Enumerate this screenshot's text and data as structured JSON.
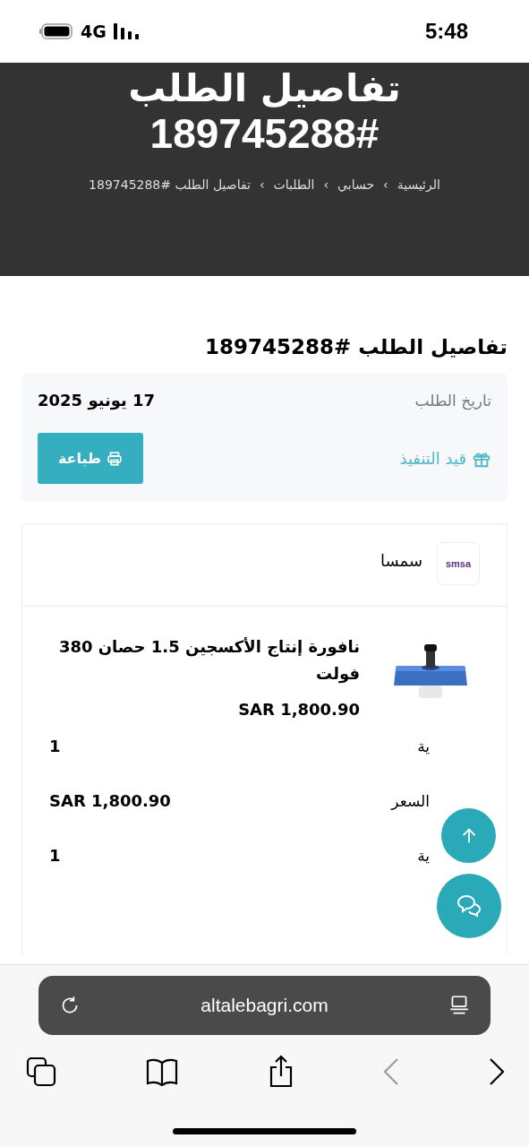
{
  "status_bar": {
    "time": "5:48",
    "network": "4G"
  },
  "header": {
    "title_line_1": "تفاصيل الطلب",
    "title_line_2": "189745288#",
    "breadcrumbs": [
      "الرئيسية",
      "حسابي",
      "الطلبات",
      "تفاصيل الطلب #189745288"
    ],
    "separator": "›"
  },
  "order": {
    "heading": "تفاصيل الطلب #189745288",
    "date_label": "تاريخ الطلب",
    "date": "17 يونيو 2025",
    "status": "قيد التنفيذ",
    "print_button": "طباعة"
  },
  "shipping": {
    "carrier": "سمسا",
    "logo_text": "smsa"
  },
  "product": {
    "name": "نافورة إنتاج الأكسجين 1.5 حصان 380 فولت",
    "price": "SAR 1,800.90",
    "details": [
      {
        "label": "ية",
        "value": "1"
      },
      {
        "label": "السعر",
        "value": "SAR 1,800.90"
      },
      {
        "label": "ية",
        "value": "1"
      }
    ]
  },
  "browser": {
    "url": "altalebagri.com"
  }
}
